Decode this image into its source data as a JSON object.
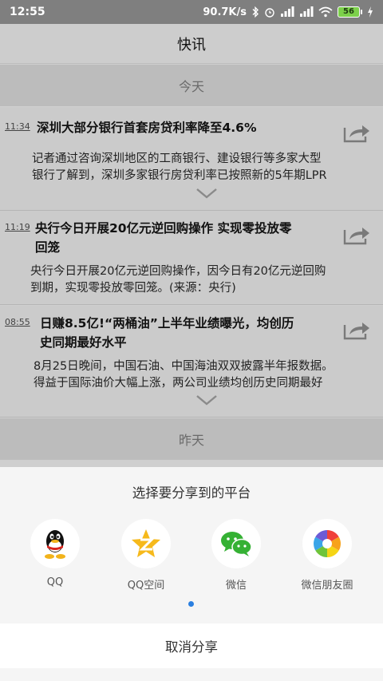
{
  "status_bar": {
    "time": "12:55",
    "speed": "90.7K/s",
    "battery": "56"
  },
  "header": {
    "title": "快讯"
  },
  "sections": {
    "today": "今天",
    "yesterday": "昨天"
  },
  "news": [
    {
      "time": "11:34",
      "title": "深圳大部分银行首套房贷利率降至4.6%",
      "summary_line1": "记者通过咨询深圳地区的工商银行、建设银行等多家大型",
      "summary_line2": "银行了解到，深圳多家银行房贷利率已按照新的5年期LPR"
    },
    {
      "time": "11:19",
      "title_line1": "央行今日开展20亿元逆回购操作 实现零投放零",
      "title_line2": "回笼",
      "summary_line1": "央行今日开展20亿元逆回购操作，因今日有20亿元逆回购",
      "summary_line2": "到期，实现零投放零回笼。(来源：央行)"
    },
    {
      "time": "08:55",
      "title_line1": "日赚8.5亿!“两桶油”上半年业绩曝光，均创历",
      "title_line2": "史同期最好水平",
      "summary_line1": "8月25日晚间，中国石油、中国海油双双披露半年报数据。",
      "summary_line2": "得益于国际油价大幅上涨，两公司业绩均创历史同期最好"
    }
  ],
  "share_sheet": {
    "title": "选择要分享到的平台",
    "platforms": [
      {
        "label": "QQ",
        "icon": "qq-icon"
      },
      {
        "label": "QQ空间",
        "icon": "qzone-icon"
      },
      {
        "label": "微信",
        "icon": "wechat-icon"
      },
      {
        "label": "微信朋友圈",
        "icon": "moments-icon"
      }
    ],
    "cancel": "取消分享"
  }
}
